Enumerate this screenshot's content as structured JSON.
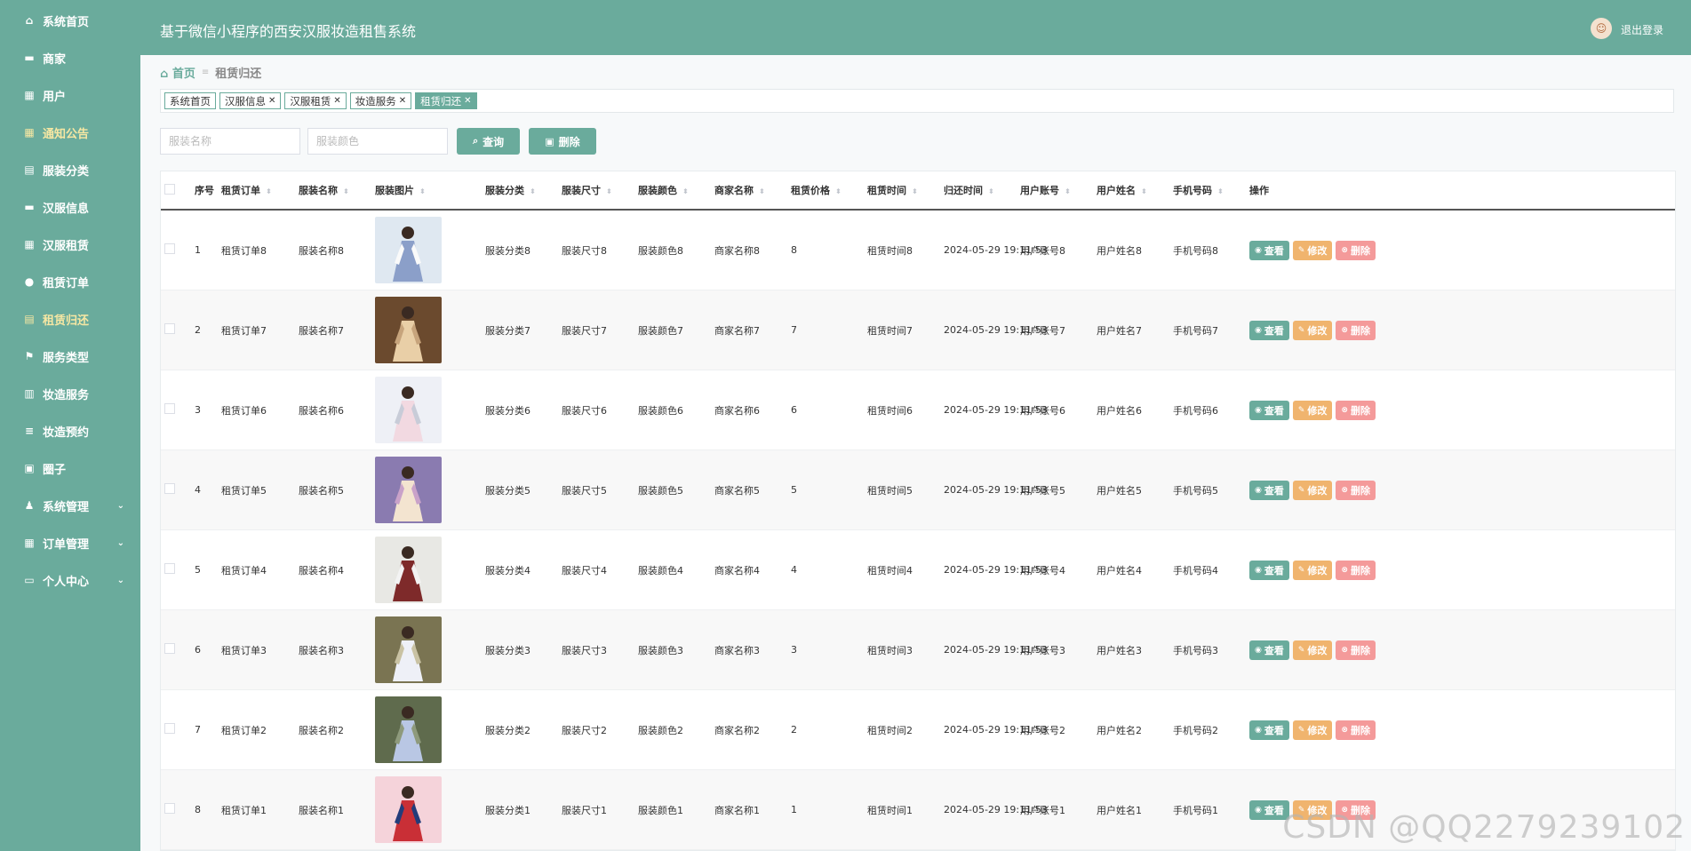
{
  "app": {
    "title": "基于微信小程序的西安汉服妆造租售系统",
    "logout": "退出登录"
  },
  "colors": {
    "primary": "#6aab9c",
    "edit": "#f0b46e",
    "delete": "#f49a9a",
    "active_menu": "#f6e7a3"
  },
  "sidebar": {
    "items": [
      {
        "label": "系统首页",
        "icon": "home-icon",
        "glyph": "⌂"
      },
      {
        "label": "商家",
        "icon": "shop-icon",
        "glyph": "▬"
      },
      {
        "label": "用户",
        "icon": "grid-icon",
        "glyph": "▦"
      },
      {
        "label": "通知公告",
        "icon": "grid-icon",
        "glyph": "▦",
        "active": true
      },
      {
        "label": "服装分类",
        "icon": "clipboard-icon",
        "glyph": "▤"
      },
      {
        "label": "汉服信息",
        "icon": "chat-icon",
        "glyph": "▬"
      },
      {
        "label": "汉服租赁",
        "icon": "grid-icon",
        "glyph": "▦"
      },
      {
        "label": "租赁订单",
        "icon": "location-icon",
        "glyph": "●"
      },
      {
        "label": "租赁归还",
        "icon": "clipboard-icon",
        "glyph": "▤",
        "active": true
      },
      {
        "label": "服务类型",
        "icon": "flag-icon",
        "glyph": "⚑"
      },
      {
        "label": "妆造服务",
        "icon": "chart-icon",
        "glyph": "▥"
      },
      {
        "label": "妆造预约",
        "icon": "list-icon",
        "glyph": "≡"
      },
      {
        "label": "圈子",
        "icon": "image-icon",
        "glyph": "▣"
      },
      {
        "label": "系统管理",
        "icon": "user-icon",
        "glyph": "♟",
        "expandable": true
      },
      {
        "label": "订单管理",
        "icon": "grid-icon",
        "glyph": "▦",
        "expandable": true
      },
      {
        "label": "个人中心",
        "icon": "card-icon",
        "glyph": "▭",
        "expandable": true
      }
    ]
  },
  "breadcrumb": {
    "home": "首页",
    "current": "租赁归还"
  },
  "tags": [
    {
      "label": "系统首页",
      "closable": false,
      "active": false
    },
    {
      "label": "汉服信息",
      "closable": true,
      "active": false
    },
    {
      "label": "汉服租赁",
      "closable": true,
      "active": false
    },
    {
      "label": "妆造服务",
      "closable": true,
      "active": false
    },
    {
      "label": "租赁归还",
      "closable": true,
      "active": true
    }
  ],
  "search": {
    "name_placeholder": "服装名称",
    "color_placeholder": "服装颜色",
    "query_label": "查询",
    "delete_label": "删除"
  },
  "table": {
    "columns": [
      "序号",
      "租赁订单",
      "服装名称",
      "服装图片",
      "服装分类",
      "服装尺寸",
      "服装颜色",
      "商家名称",
      "租赁价格",
      "租赁时间",
      "归还时间",
      "用户账号",
      "用户姓名",
      "手机号码",
      "操作"
    ],
    "actions": {
      "view": "查看",
      "edit": "修改",
      "delete": "删除"
    },
    "rows": [
      {
        "no": "1",
        "order": "租赁订单8",
        "name": "服装名称8",
        "category": "服装分类8",
        "size": "服装尺寸8",
        "color": "服装颜色8",
        "merchant": "商家名称8",
        "price": "8",
        "rent_time": "租赁时间8",
        "return_time": "2024-05-29 19:11:53",
        "account": "用户账号8",
        "user_name": "用户姓名8",
        "phone": "手机号码8"
      },
      {
        "no": "2",
        "order": "租赁订单7",
        "name": "服装名称7",
        "category": "服装分类7",
        "size": "服装尺寸7",
        "color": "服装颜色7",
        "merchant": "商家名称7",
        "price": "7",
        "rent_time": "租赁时间7",
        "return_time": "2024-05-29 19:11:53",
        "account": "用户账号7",
        "user_name": "用户姓名7",
        "phone": "手机号码7"
      },
      {
        "no": "3",
        "order": "租赁订单6",
        "name": "服装名称6",
        "category": "服装分类6",
        "size": "服装尺寸6",
        "color": "服装颜色6",
        "merchant": "商家名称6",
        "price": "6",
        "rent_time": "租赁时间6",
        "return_time": "2024-05-29 19:11:53",
        "account": "用户账号6",
        "user_name": "用户姓名6",
        "phone": "手机号码6"
      },
      {
        "no": "4",
        "order": "租赁订单5",
        "name": "服装名称5",
        "category": "服装分类5",
        "size": "服装尺寸5",
        "color": "服装颜色5",
        "merchant": "商家名称5",
        "price": "5",
        "rent_time": "租赁时间5",
        "return_time": "2024-05-29 19:11:53",
        "account": "用户账号5",
        "user_name": "用户姓名5",
        "phone": "手机号码5"
      },
      {
        "no": "5",
        "order": "租赁订单4",
        "name": "服装名称4",
        "category": "服装分类4",
        "size": "服装尺寸4",
        "color": "服装颜色4",
        "merchant": "商家名称4",
        "price": "4",
        "rent_time": "租赁时间4",
        "return_time": "2024-05-29 19:11:53",
        "account": "用户账号4",
        "user_name": "用户姓名4",
        "phone": "手机号码4"
      },
      {
        "no": "6",
        "order": "租赁订单3",
        "name": "服装名称3",
        "category": "服装分类3",
        "size": "服装尺寸3",
        "color": "服装颜色3",
        "merchant": "商家名称3",
        "price": "3",
        "rent_time": "租赁时间3",
        "return_time": "2024-05-29 19:11:53",
        "account": "用户账号3",
        "user_name": "用户姓名3",
        "phone": "手机号码3"
      },
      {
        "no": "7",
        "order": "租赁订单2",
        "name": "服装名称2",
        "category": "服装分类2",
        "size": "服装尺寸2",
        "color": "服装颜色2",
        "merchant": "商家名称2",
        "price": "2",
        "rent_time": "租赁时间2",
        "return_time": "2024-05-29 19:11:53",
        "account": "用户账号2",
        "user_name": "用户姓名2",
        "phone": "手机号码2"
      },
      {
        "no": "8",
        "order": "租赁订单1",
        "name": "服装名称1",
        "category": "服装分类1",
        "size": "服装尺寸1",
        "color": "服装颜色1",
        "merchant": "商家名称1",
        "price": "1",
        "rent_time": "租赁时间1",
        "return_time": "2024-05-29 19:11:53",
        "account": "用户账号1",
        "user_name": "用户姓名1",
        "phone": "手机号码1"
      }
    ]
  },
  "watermark": "CSDN @QQ2279239102"
}
